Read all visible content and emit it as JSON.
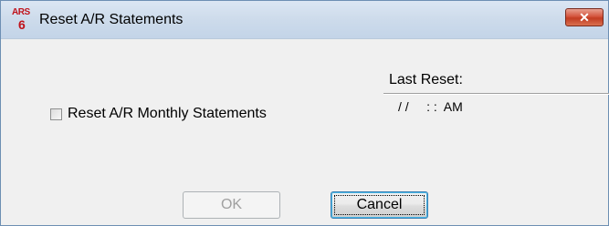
{
  "window": {
    "title": "Reset A/R Statements",
    "icon_top": "ARS",
    "icon_bottom": "6",
    "close_symbol": "✕"
  },
  "last_reset": {
    "label": "Last Reset:",
    "value": "/ /     : :  AM"
  },
  "options": {
    "reset_monthly_label": "Reset A/R Monthly Statements",
    "reset_monthly_checked": false
  },
  "buttons": {
    "ok_label": "OK",
    "ok_enabled": false,
    "cancel_label": "Cancel"
  }
}
